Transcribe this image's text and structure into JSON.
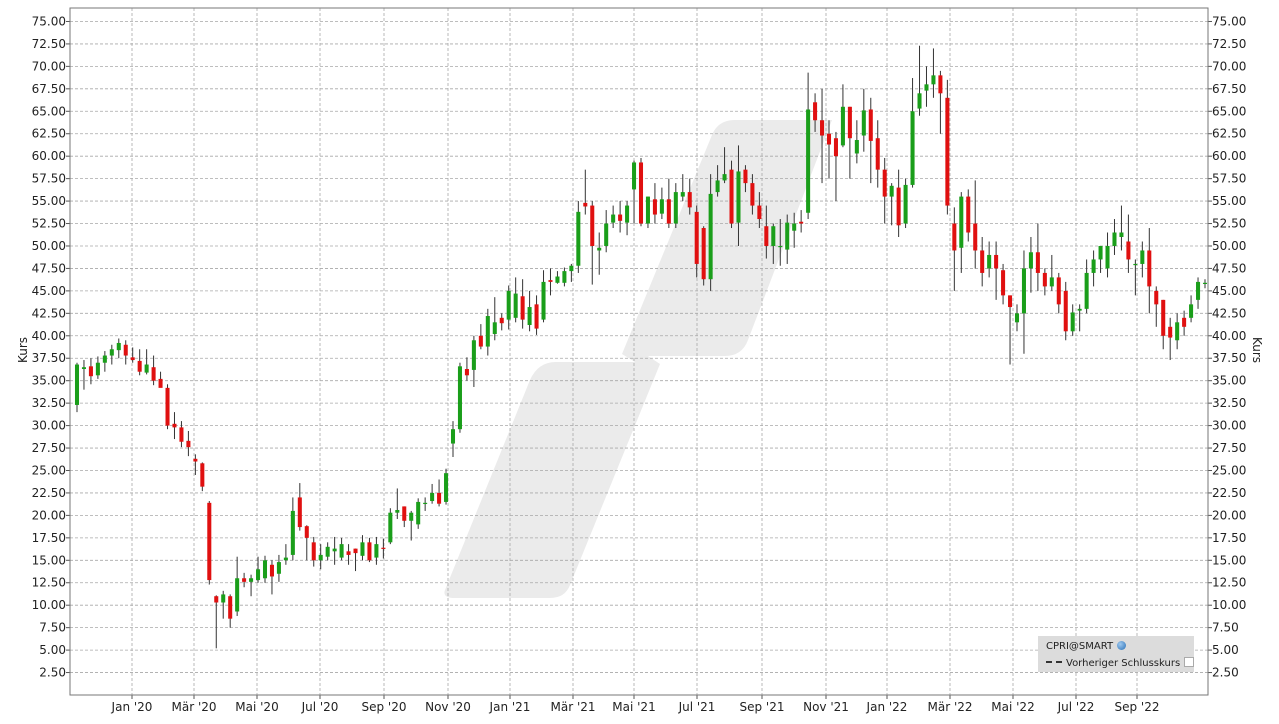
{
  "chart_data": {
    "type": "candlestick",
    "ylabel_left": "Kurs",
    "ylabel_right": "Kurs",
    "ylim": [
      0,
      76.5
    ],
    "yticks": [
      "2.50",
      "5.00",
      "7.50",
      "10.00",
      "12.50",
      "15.00",
      "17.50",
      "20.00",
      "22.50",
      "25.00",
      "27.50",
      "30.00",
      "32.50",
      "35.00",
      "37.50",
      "40.00",
      "42.50",
      "45.00",
      "47.50",
      "50.00",
      "52.50",
      "55.00",
      "57.50",
      "60.00",
      "62.50",
      "65.00",
      "67.50",
      "70.00",
      "72.50",
      "75.00"
    ],
    "xticks": [
      "Jan '20",
      "Mär '20",
      "Mai '20",
      "Jul '20",
      "Sep '20",
      "Nov '20",
      "Jan '21",
      "Mär '21",
      "Mai '21",
      "Jul '21",
      "Sep '21",
      "Nov '21",
      "Jan '22",
      "Mär '22",
      "Mai '22",
      "Jul '22",
      "Sep '22"
    ],
    "grid": true,
    "up_color": "#1a9e1a",
    "down_color": "#e01010",
    "legend": {
      "series_name": "CPRI@SMART",
      "previous_close_label": "Vorheriger Schlusskurs",
      "placement": "bottom-right"
    },
    "candles": [
      [
        32.3,
        36.8,
        31.5,
        37.0
      ],
      [
        36.3,
        36.5,
        34.0,
        37.3
      ],
      [
        36.6,
        35.5,
        34.6,
        37.5
      ],
      [
        35.6,
        37.0,
        35.2,
        37.7
      ],
      [
        37.0,
        37.8,
        36.0,
        38.3
      ],
      [
        37.8,
        38.5,
        36.8,
        39.0
      ],
      [
        38.4,
        39.2,
        37.5,
        39.7
      ],
      [
        39.0,
        37.8,
        36.8,
        39.5
      ],
      [
        37.6,
        37.3,
        37.0,
        38.7
      ],
      [
        37.2,
        36.0,
        35.6,
        38.5
      ],
      [
        35.9,
        36.8,
        35.7,
        38.5
      ],
      [
        36.5,
        35.0,
        34.5,
        37.8
      ],
      [
        35.2,
        34.2,
        34.4,
        36.0
      ],
      [
        34.2,
        30.0,
        29.6,
        34.6
      ],
      [
        30.2,
        29.8,
        28.5,
        31.5
      ],
      [
        29.8,
        28.2,
        27.6,
        30.5
      ],
      [
        28.3,
        27.6,
        26.6,
        29.4
      ],
      [
        26.3,
        26.0,
        24.5,
        26.8
      ],
      [
        25.8,
        23.2,
        22.7,
        25.9
      ],
      [
        21.4,
        12.8,
        12.3,
        21.6
      ],
      [
        11.0,
        10.3,
        5.2,
        11.1
      ],
      [
        10.3,
        11.2,
        8.5,
        11.6
      ],
      [
        11.0,
        8.5,
        7.5,
        11.2
      ],
      [
        9.3,
        13.0,
        8.8,
        15.4
      ],
      [
        13.0,
        12.6,
        12.0,
        13.6
      ],
      [
        12.6,
        13.0,
        11.0,
        13.4
      ],
      [
        12.8,
        14.0,
        12.5,
        15.4
      ],
      [
        13.0,
        15.0,
        12.5,
        15.5
      ],
      [
        14.5,
        13.2,
        11.2,
        15.0
      ],
      [
        13.5,
        14.8,
        12.6,
        15.6
      ],
      [
        15.0,
        15.3,
        14.5,
        16.8
      ],
      [
        15.6,
        20.5,
        15.0,
        22.0
      ],
      [
        22.0,
        18.7,
        18.3,
        23.6
      ],
      [
        18.8,
        17.5,
        15.0,
        18.9
      ],
      [
        17.0,
        15.0,
        14.3,
        17.6
      ],
      [
        15.0,
        15.6,
        14.0,
        16.8
      ],
      [
        15.4,
        16.5,
        15.0,
        17.0
      ],
      [
        16.0,
        16.3,
        14.5,
        17.6
      ],
      [
        15.3,
        16.8,
        15.0,
        17.5
      ],
      [
        16.0,
        15.6,
        14.5,
        16.8
      ],
      [
        16.3,
        15.8,
        13.8,
        16.3
      ],
      [
        15.5,
        17.0,
        15.0,
        17.8
      ],
      [
        17.0,
        15.0,
        14.8,
        17.5
      ],
      [
        15.3,
        16.8,
        14.5,
        17.6
      ],
      [
        16.4,
        16.3,
        15.2,
        17.4
      ],
      [
        17.0,
        20.3,
        16.8,
        20.8
      ],
      [
        20.3,
        20.6,
        19.6,
        23.0
      ],
      [
        21.0,
        19.4,
        18.7,
        21.0
      ],
      [
        19.4,
        20.3,
        17.2,
        20.5
      ],
      [
        19.0,
        21.5,
        18.5,
        21.9
      ],
      [
        21.3,
        21.4,
        20.5,
        22.0
      ],
      [
        21.6,
        22.5,
        21.3,
        23.5
      ],
      [
        22.5,
        21.3,
        21.0,
        24.0
      ],
      [
        21.5,
        24.7,
        21.2,
        25.2
      ],
      [
        28.0,
        29.6,
        26.5,
        30.5
      ],
      [
        29.6,
        36.6,
        29.2,
        37.0
      ],
      [
        36.3,
        35.6,
        35.0,
        37.6
      ],
      [
        36.2,
        39.5,
        34.3,
        40.0
      ],
      [
        40.0,
        38.8,
        38.5,
        41.3
      ],
      [
        38.8,
        42.2,
        37.8,
        43.0
      ],
      [
        40.2,
        41.5,
        39.5,
        44.3
      ],
      [
        42.0,
        41.4,
        40.6,
        42.5
      ],
      [
        41.8,
        45.0,
        40.7,
        45.6
      ],
      [
        42.0,
        44.7,
        41.5,
        46.5
      ],
      [
        44.4,
        41.8,
        40.8,
        46.3
      ],
      [
        41.2,
        43.2,
        40.5,
        45.0
      ],
      [
        43.5,
        40.8,
        40.1,
        44.5
      ],
      [
        41.8,
        46.0,
        41.5,
        47.3
      ],
      [
        46.2,
        46.0,
        44.5,
        47.5
      ],
      [
        45.9,
        46.6,
        45.8,
        47.2
      ],
      [
        45.9,
        47.2,
        45.5,
        47.6
      ],
      [
        47.2,
        47.8,
        46.0,
        48.0
      ],
      [
        47.8,
        53.8,
        47.0,
        55.0
      ],
      [
        54.8,
        54.4,
        53.5,
        58.5
      ],
      [
        54.5,
        50.0,
        45.7,
        55.0
      ],
      [
        49.5,
        49.8,
        46.8,
        51.5
      ],
      [
        50.0,
        52.5,
        49.3,
        54.0
      ],
      [
        52.6,
        53.5,
        52.0,
        54.5
      ],
      [
        53.5,
        52.8,
        51.5,
        55.0
      ],
      [
        52.6,
        54.5,
        51.2,
        55.0
      ],
      [
        56.3,
        59.3,
        52.5,
        59.5
      ],
      [
        59.3,
        52.5,
        52.2,
        59.8
      ],
      [
        52.5,
        55.5,
        52.0,
        55.5
      ],
      [
        55.2,
        53.5,
        52.5,
        57.0
      ],
      [
        53.6,
        55.2,
        53.0,
        56.5
      ],
      [
        55.2,
        52.5,
        52.0,
        57.5
      ],
      [
        52.5,
        56.0,
        52.0,
        57.0
      ],
      [
        55.5,
        56.0,
        55.0,
        58.0
      ],
      [
        56.0,
        54.3,
        53.5,
        57.5
      ],
      [
        53.8,
        48.0,
        46.5,
        54.5
      ],
      [
        52.0,
        46.3,
        45.6,
        52.2
      ],
      [
        46.3,
        55.8,
        45.0,
        58.0
      ],
      [
        56.0,
        57.3,
        55.5,
        59.0
      ],
      [
        57.3,
        58.0,
        57.0,
        61.0
      ],
      [
        58.5,
        52.5,
        52.0,
        59.5
      ],
      [
        52.6,
        58.3,
        50.0,
        61.2
      ],
      [
        58.5,
        57.0,
        56.0,
        59.0
      ],
      [
        57.0,
        54.5,
        53.5,
        58.0
      ],
      [
        54.5,
        53.0,
        52.0,
        56.0
      ],
      [
        52.2,
        50.0,
        48.6,
        54.5
      ],
      [
        50.0,
        52.2,
        48.0,
        52.5
      ],
      [
        50.0,
        50.0,
        47.8,
        53.0
      ],
      [
        49.6,
        52.6,
        48.0,
        53.5
      ],
      [
        51.7,
        52.5,
        49.8,
        53.7
      ],
      [
        52.7,
        52.5,
        51.5,
        54.0
      ],
      [
        53.7,
        65.2,
        53.0,
        69.3
      ],
      [
        66.0,
        64.0,
        62.7,
        67.0
      ],
      [
        64.0,
        62.3,
        57.0,
        67.5
      ],
      [
        62.5,
        61.3,
        57.5,
        64.0
      ],
      [
        62.0,
        60.0,
        55.0,
        62.7
      ],
      [
        61.2,
        65.5,
        61.0,
        68.0
      ],
      [
        65.5,
        62.0,
        57.5,
        65.5
      ],
      [
        60.3,
        61.8,
        59.2,
        64.0
      ],
      [
        62.3,
        65.1,
        60.5,
        67.5
      ],
      [
        65.2,
        61.7,
        57.0,
        66.5
      ],
      [
        62.0,
        58.5,
        56.5,
        64.0
      ],
      [
        58.5,
        55.5,
        52.5,
        59.8
      ],
      [
        55.5,
        56.7,
        52.3,
        57.0
      ],
      [
        56.5,
        52.3,
        51.0,
        58.5
      ],
      [
        52.5,
        56.8,
        52.0,
        57.5
      ],
      [
        56.8,
        65.0,
        56.5,
        68.7
      ],
      [
        65.3,
        67.0,
        64.5,
        72.3
      ],
      [
        67.3,
        68.0,
        65.5,
        70.0
      ],
      [
        68.0,
        69.0,
        66.5,
        72.0
      ],
      [
        69.0,
        67.0,
        62.5,
        69.5
      ],
      [
        66.5,
        54.5,
        53.5,
        68.5
      ],
      [
        52.5,
        49.5,
        45.0,
        54.3
      ],
      [
        49.8,
        55.5,
        47.0,
        56.0
      ],
      [
        55.5,
        51.5,
        50.5,
        56.3
      ],
      [
        52.5,
        49.5,
        47.5,
        57.3
      ],
      [
        49.5,
        47.0,
        45.5,
        51.0
      ],
      [
        47.5,
        49.0,
        46.5,
        50.5
      ],
      [
        49.0,
        47.5,
        44.0,
        50.5
      ],
      [
        47.3,
        44.5,
        43.5,
        48.0
      ],
      [
        44.5,
        43.2,
        36.8,
        44.5
      ],
      [
        41.5,
        42.5,
        40.5,
        43.5
      ],
      [
        42.5,
        47.5,
        38.0,
        49.5
      ],
      [
        47.5,
        49.3,
        44.8,
        51.0
      ],
      [
        49.3,
        47.0,
        45.0,
        52.5
      ],
      [
        47.0,
        45.5,
        44.5,
        47.5
      ],
      [
        45.5,
        46.5,
        45.0,
        49.0
      ],
      [
        46.5,
        43.5,
        42.5,
        47.0
      ],
      [
        45.0,
        40.5,
        39.5,
        46.0
      ],
      [
        40.5,
        42.6,
        40.0,
        43.5
      ],
      [
        42.8,
        43.0,
        40.5,
        43.5
      ],
      [
        43.0,
        47.0,
        42.5,
        48.5
      ],
      [
        47.0,
        48.5,
        45.5,
        49.5
      ],
      [
        48.5,
        50.0,
        47.0,
        50.0
      ],
      [
        47.5,
        50.0,
        46.5,
        51.5
      ],
      [
        50.0,
        51.5,
        49.0,
        53.0
      ],
      [
        51.0,
        51.5,
        49.5,
        54.5
      ],
      [
        50.5,
        48.5,
        47.0,
        53.5
      ],
      [
        48.0,
        48.0,
        44.5,
        48.5
      ],
      [
        48.0,
        49.5,
        46.5,
        50.5
      ],
      [
        49.5,
        45.5,
        42.5,
        52.0
      ],
      [
        45.0,
        43.5,
        41.0,
        45.5
      ],
      [
        44.0,
        40.0,
        38.5,
        44.0
      ],
      [
        41.0,
        39.8,
        37.3,
        42.0
      ],
      [
        39.5,
        41.5,
        38.5,
        42.5
      ],
      [
        42.0,
        41.0,
        40.0,
        42.8
      ],
      [
        42.0,
        43.5,
        41.5,
        44.5
      ],
      [
        44.0,
        46.0,
        43.0,
        46.5
      ],
      [
        45.8,
        45.9,
        45.3,
        46.3
      ]
    ]
  }
}
